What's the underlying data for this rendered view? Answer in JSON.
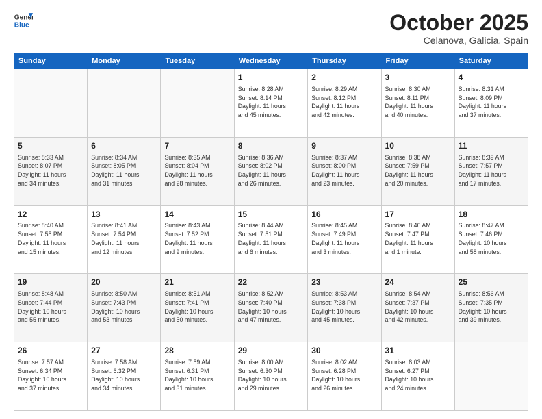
{
  "logo": {
    "line1": "General",
    "line2": "Blue"
  },
  "title": "October 2025",
  "subtitle": "Celanova, Galicia, Spain",
  "days_of_week": [
    "Sunday",
    "Monday",
    "Tuesday",
    "Wednesday",
    "Thursday",
    "Friday",
    "Saturday"
  ],
  "weeks": [
    [
      {
        "day": "",
        "info": ""
      },
      {
        "day": "",
        "info": ""
      },
      {
        "day": "",
        "info": ""
      },
      {
        "day": "1",
        "info": "Sunrise: 8:28 AM\nSunset: 8:14 PM\nDaylight: 11 hours\nand 45 minutes."
      },
      {
        "day": "2",
        "info": "Sunrise: 8:29 AM\nSunset: 8:12 PM\nDaylight: 11 hours\nand 42 minutes."
      },
      {
        "day": "3",
        "info": "Sunrise: 8:30 AM\nSunset: 8:11 PM\nDaylight: 11 hours\nand 40 minutes."
      },
      {
        "day": "4",
        "info": "Sunrise: 8:31 AM\nSunset: 8:09 PM\nDaylight: 11 hours\nand 37 minutes."
      }
    ],
    [
      {
        "day": "5",
        "info": "Sunrise: 8:33 AM\nSunset: 8:07 PM\nDaylight: 11 hours\nand 34 minutes."
      },
      {
        "day": "6",
        "info": "Sunrise: 8:34 AM\nSunset: 8:05 PM\nDaylight: 11 hours\nand 31 minutes."
      },
      {
        "day": "7",
        "info": "Sunrise: 8:35 AM\nSunset: 8:04 PM\nDaylight: 11 hours\nand 28 minutes."
      },
      {
        "day": "8",
        "info": "Sunrise: 8:36 AM\nSunset: 8:02 PM\nDaylight: 11 hours\nand 26 minutes."
      },
      {
        "day": "9",
        "info": "Sunrise: 8:37 AM\nSunset: 8:00 PM\nDaylight: 11 hours\nand 23 minutes."
      },
      {
        "day": "10",
        "info": "Sunrise: 8:38 AM\nSunset: 7:59 PM\nDaylight: 11 hours\nand 20 minutes."
      },
      {
        "day": "11",
        "info": "Sunrise: 8:39 AM\nSunset: 7:57 PM\nDaylight: 11 hours\nand 17 minutes."
      }
    ],
    [
      {
        "day": "12",
        "info": "Sunrise: 8:40 AM\nSunset: 7:55 PM\nDaylight: 11 hours\nand 15 minutes."
      },
      {
        "day": "13",
        "info": "Sunrise: 8:41 AM\nSunset: 7:54 PM\nDaylight: 11 hours\nand 12 minutes."
      },
      {
        "day": "14",
        "info": "Sunrise: 8:43 AM\nSunset: 7:52 PM\nDaylight: 11 hours\nand 9 minutes."
      },
      {
        "day": "15",
        "info": "Sunrise: 8:44 AM\nSunset: 7:51 PM\nDaylight: 11 hours\nand 6 minutes."
      },
      {
        "day": "16",
        "info": "Sunrise: 8:45 AM\nSunset: 7:49 PM\nDaylight: 11 hours\nand 3 minutes."
      },
      {
        "day": "17",
        "info": "Sunrise: 8:46 AM\nSunset: 7:47 PM\nDaylight: 11 hours\nand 1 minute."
      },
      {
        "day": "18",
        "info": "Sunrise: 8:47 AM\nSunset: 7:46 PM\nDaylight: 10 hours\nand 58 minutes."
      }
    ],
    [
      {
        "day": "19",
        "info": "Sunrise: 8:48 AM\nSunset: 7:44 PM\nDaylight: 10 hours\nand 55 minutes."
      },
      {
        "day": "20",
        "info": "Sunrise: 8:50 AM\nSunset: 7:43 PM\nDaylight: 10 hours\nand 53 minutes."
      },
      {
        "day": "21",
        "info": "Sunrise: 8:51 AM\nSunset: 7:41 PM\nDaylight: 10 hours\nand 50 minutes."
      },
      {
        "day": "22",
        "info": "Sunrise: 8:52 AM\nSunset: 7:40 PM\nDaylight: 10 hours\nand 47 minutes."
      },
      {
        "day": "23",
        "info": "Sunrise: 8:53 AM\nSunset: 7:38 PM\nDaylight: 10 hours\nand 45 minutes."
      },
      {
        "day": "24",
        "info": "Sunrise: 8:54 AM\nSunset: 7:37 PM\nDaylight: 10 hours\nand 42 minutes."
      },
      {
        "day": "25",
        "info": "Sunrise: 8:56 AM\nSunset: 7:35 PM\nDaylight: 10 hours\nand 39 minutes."
      }
    ],
    [
      {
        "day": "26",
        "info": "Sunrise: 7:57 AM\nSunset: 6:34 PM\nDaylight: 10 hours\nand 37 minutes."
      },
      {
        "day": "27",
        "info": "Sunrise: 7:58 AM\nSunset: 6:32 PM\nDaylight: 10 hours\nand 34 minutes."
      },
      {
        "day": "28",
        "info": "Sunrise: 7:59 AM\nSunset: 6:31 PM\nDaylight: 10 hours\nand 31 minutes."
      },
      {
        "day": "29",
        "info": "Sunrise: 8:00 AM\nSunset: 6:30 PM\nDaylight: 10 hours\nand 29 minutes."
      },
      {
        "day": "30",
        "info": "Sunrise: 8:02 AM\nSunset: 6:28 PM\nDaylight: 10 hours\nand 26 minutes."
      },
      {
        "day": "31",
        "info": "Sunrise: 8:03 AM\nSunset: 6:27 PM\nDaylight: 10 hours\nand 24 minutes."
      },
      {
        "day": "",
        "info": ""
      }
    ]
  ]
}
